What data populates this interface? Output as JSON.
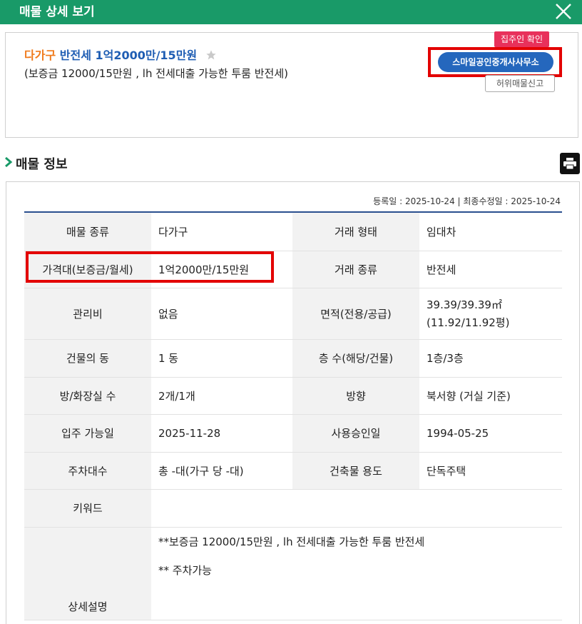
{
  "window": {
    "title": "매물 상세 보기"
  },
  "summary": {
    "type_label": "다가구",
    "deal_headline": "반전세 1억2000만/15만원",
    "subtitle": "(보증금 12000/15만원 , lh 전세대출 가능한 투룸 반전세)",
    "owner_badge": "집주인 확인",
    "agent_button": "스마일공인중개사사무소",
    "report_button": "허위매물신고"
  },
  "section": {
    "title": "매물 정보"
  },
  "dates": "등록일 : 2025-10-24 | 최종수정일 : 2025-10-24",
  "rows": [
    {
      "l1": "매물 종류",
      "v1": "다가구",
      "l2": "거래 형태",
      "v2": "임대차"
    },
    {
      "l1": "가격대(보증금/월세)",
      "v1": "1억2000만/15만원",
      "l2": "거래 종류",
      "v2": "반전세"
    },
    {
      "l1": "관리비",
      "v1": "없음",
      "l2": "면적(전용/공급)",
      "v2a": "39.39/39.39㎡",
      "v2b": "(11.92/11.92평)"
    },
    {
      "l1": "건물의 동",
      "v1": "1 동",
      "l2": "층 수(해당/건물)",
      "v2": "1층/3층"
    },
    {
      "l1": "방/화장실 수",
      "v1": "2개/1개",
      "l2": "방향",
      "v2": "북서향 (거실 기준)"
    },
    {
      "l1": "입주 가능일",
      "v1": "2025-11-28",
      "l2": "사용승인일",
      "v2": "1994-05-25"
    },
    {
      "l1": "주차대수",
      "v1": "총 -대(가구 당 -대)",
      "l2": "건축물 용도",
      "v2": "단독주택"
    },
    {
      "l1": "키워드",
      "v1": ""
    },
    {
      "l1": "상세설명",
      "line1": "**보증금 12000/15만원 , lh 전세대출 가능한 투룸 반전세",
      "line2": "** 주차가능"
    }
  ],
  "colors": {
    "titlebar": "#199a68",
    "type": "#f07a1b",
    "deal": "#1e5db3",
    "badge": "#e8315b",
    "agent": "#2567bd",
    "highlight": "#e30000"
  }
}
